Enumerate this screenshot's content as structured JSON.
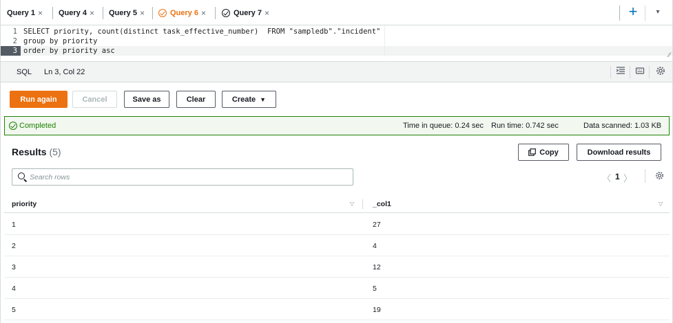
{
  "tabs": [
    {
      "label": "Query 1",
      "close": "×",
      "active": false,
      "status": ""
    },
    {
      "label": "Query 4",
      "close": "×",
      "active": false,
      "status": ""
    },
    {
      "label": "Query 5",
      "close": "×",
      "active": false,
      "status": ""
    },
    {
      "label": "Query 6",
      "close": "×",
      "active": true,
      "status": "completed"
    },
    {
      "label": "Query 7",
      "close": "×",
      "active": false,
      "status": "completed"
    }
  ],
  "tab_actions": {
    "add": "+",
    "menu": "▾"
  },
  "editor": {
    "lines": [
      {
        "num": "1",
        "text": "SELECT priority, count(distinct task_effective_number)  FROM \"sampledb\".\"incident\""
      },
      {
        "num": "2",
        "text": "group by priority"
      },
      {
        "num": "3",
        "text": "order by priority asc"
      }
    ],
    "resize": "⁄⁄"
  },
  "status_bar": {
    "language": "SQL",
    "cursor_position": "Ln 3, Col 22",
    "icons": [
      "indent-icon",
      "keyboard-icon",
      "settings-icon"
    ]
  },
  "actions": {
    "run_again": "Run again",
    "cancel": "Cancel",
    "save_as": "Save as",
    "clear": "Clear",
    "create": "Create",
    "create_caret": "▼"
  },
  "execution": {
    "status": "Completed",
    "time_in_queue_label": "Time in queue:",
    "time_in_queue": "0.24 sec",
    "run_time_label": "Run time:",
    "run_time": "0.742 sec",
    "data_scanned_label": "Data scanned:",
    "data_scanned": "1.03 KB"
  },
  "results": {
    "title": "Results",
    "count": "(5)",
    "copy_button": "Copy",
    "download_button": "Download results",
    "search_placeholder": "Search rows",
    "pagination": {
      "prev": "〈",
      "page": "1",
      "next": "〉"
    },
    "columns": [
      {
        "label": "priority",
        "sort": "▽"
      },
      {
        "label": "_col1",
        "sort": "▽"
      }
    ],
    "rows": [
      {
        "priority": "1",
        "col1": "27"
      },
      {
        "priority": "2",
        "col1": "4"
      },
      {
        "priority": "3",
        "col1": "12"
      },
      {
        "priority": "4",
        "col1": "5"
      },
      {
        "priority": "5",
        "col1": "19"
      }
    ]
  },
  "colors": {
    "accent": "#ec7211",
    "success": "#1d8102",
    "link": "#0073bb"
  }
}
